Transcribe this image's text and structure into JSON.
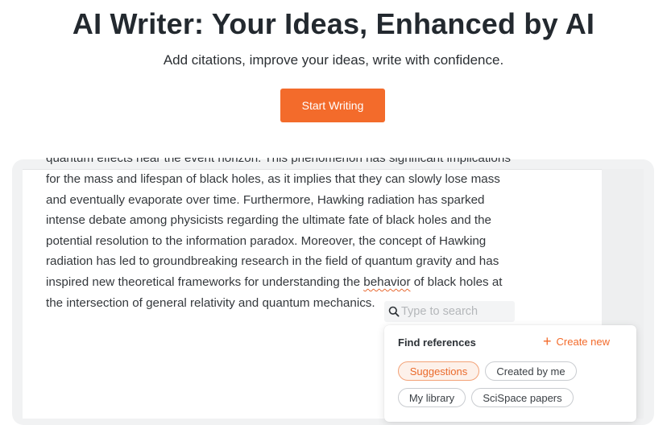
{
  "hero": {
    "title": "AI Writer: Your Ideas, Enhanced by AI",
    "subtitle": "Add citations, improve your ideas, write with confidence.",
    "cta_label": "Start Writing"
  },
  "document": {
    "clipped_line": "quantum effects near the event horizon. This phenomenon has significant implications",
    "lines": [
      "for the mass and lifespan of black holes, as it implies that they can slowly lose mass",
      "and eventually evaporate over time. Furthermore, Hawking radiation has sparked",
      "intense debate among physicists regarding the ultimate fate of black holes and the",
      "potential resolution to the information paradox. Moreover, the concept of Hawking",
      "radiation has led to groundbreaking research in the field of quantum gravity and has"
    ],
    "line6_before": "inspired new theoretical frameworks for understanding the ",
    "line6_underlined": "behavior",
    "line6_after": " of black holes at",
    "last_line": "the intersection of general relativity and quantum mechanics."
  },
  "search": {
    "placeholder": "Type to search",
    "icon": "search-icon"
  },
  "references": {
    "title": "Find references",
    "create_label": "Create new",
    "chips": [
      {
        "label": "Suggestions",
        "active": true
      },
      {
        "label": "Created by me",
        "active": false
      },
      {
        "label": "My library",
        "active": false
      },
      {
        "label": "SciSpace papers",
        "active": false
      }
    ]
  },
  "colors": {
    "accent": "#f36b2b",
    "title_text": "#23292f",
    "body_text": "#34383c"
  }
}
